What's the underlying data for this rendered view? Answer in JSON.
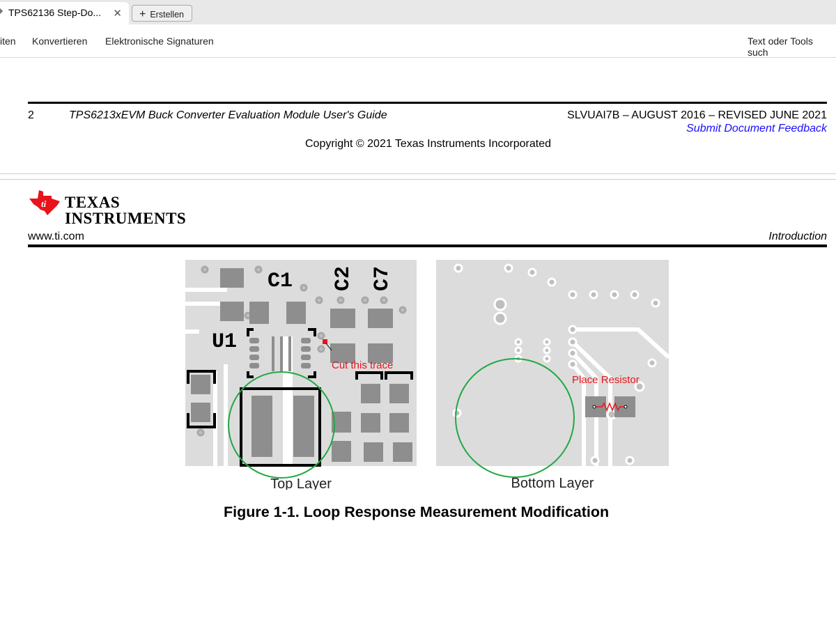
{
  "tabs": {
    "active_title": "TPS62136 Step-Do...",
    "new_button": "Erstellen"
  },
  "toolbar": {
    "items": [
      "iten",
      "Konvertieren",
      "Elektronische Signaturen"
    ],
    "search": "Text oder Tools such"
  },
  "page_footer": {
    "page_number": "2",
    "doc_title": "TPS6213xEVM Buck Converter Evaluation Module User's Guide",
    "doc_id": "SLVUAI7B – AUGUST 2016 – REVISED JUNE 2021",
    "feedback_link": "Submit Document Feedback",
    "copyright": "Copyright © 2021 Texas Instruments Incorporated"
  },
  "page_header": {
    "logo_line1": "Texas",
    "logo_line2": "Instruments",
    "website": "www.ti.com",
    "section": "Introduction"
  },
  "figure": {
    "top_layer_label": "Top Layer",
    "bottom_layer_label": "Bottom Layer",
    "cut_annotation": "Cut this trace",
    "place_annotation": "Place Resistor",
    "refdes": [
      "C1",
      "C2",
      "C7",
      "U1"
    ],
    "caption": "Figure 1-1. Loop Response Measurement Modification"
  },
  "colors": {
    "annotation": "#e8141c",
    "circle": "#22a845",
    "link": "#1a0dff",
    "ti_red": "#e8141c"
  }
}
